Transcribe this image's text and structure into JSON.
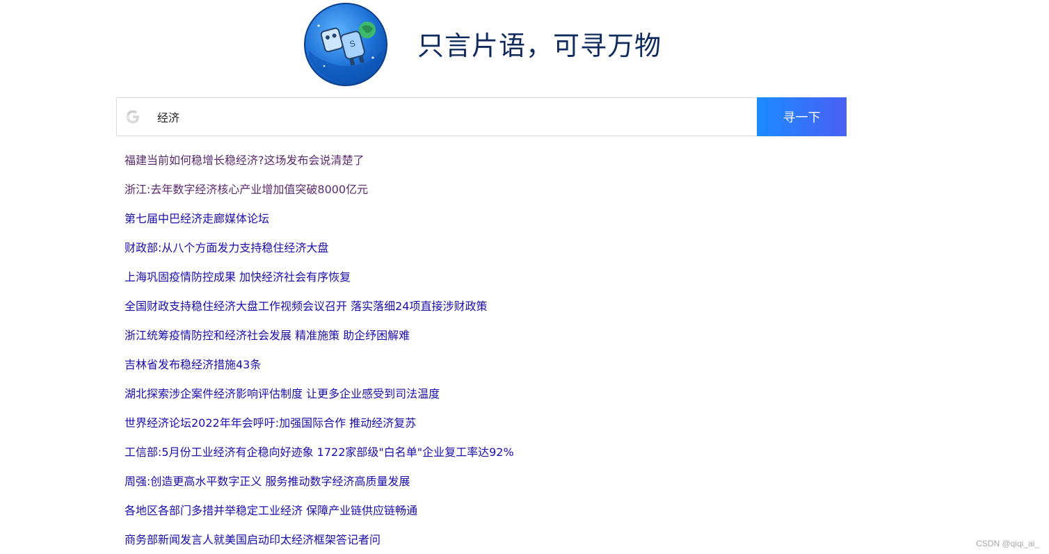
{
  "header": {
    "slogan": "只言片语，可寻万物"
  },
  "search": {
    "query": "经济",
    "button_label": "寻一下",
    "icon": "google-g-icon"
  },
  "results": [
    {
      "title": "福建当前如何稳增长稳经济?这场发布会说清楚了",
      "visited": true
    },
    {
      "title": "浙江:去年数字经济核心产业增加值突破8000亿元",
      "visited": true
    },
    {
      "title": "第七届中巴经济走廊媒体论坛",
      "visited": false
    },
    {
      "title": "财政部:从八个方面发力支持稳住经济大盘",
      "visited": false
    },
    {
      "title": "上海巩固疫情防控成果 加快经济社会有序恢复",
      "visited": false
    },
    {
      "title": "全国财政支持稳住经济大盘工作视频会议召开 落实落细24项直接涉财政策",
      "visited": false
    },
    {
      "title": "浙江统筹疫情防控和经济社会发展 精准施策 助企纾困解难",
      "visited": false
    },
    {
      "title": "吉林省发布稳经济措施43条",
      "visited": false
    },
    {
      "title": "湖北探索涉企案件经济影响评估制度 让更多企业感受到司法温度",
      "visited": false
    },
    {
      "title": "世界经济论坛2022年年会呼吁:加强国际合作 推动经济复苏",
      "visited": false
    },
    {
      "title": "工信部:5月份工业经济有企稳向好迹象 1722家部级\"白名单\"企业复工率达92%",
      "visited": false
    },
    {
      "title": "周强:创造更高水平数字正义 服务推动数字经济高质量发展",
      "visited": false
    },
    {
      "title": "各地区各部门多措并举稳定工业经济 保障产业链供应链畅通",
      "visited": false
    },
    {
      "title": "商务部新闻发言人就美国启动印太经济框架答记者问",
      "visited": false
    }
  ],
  "watermark": "CSDN @qiqi_ai_",
  "colors": {
    "link": "#1a0dab",
    "link_visited": "#5a2a6f",
    "button_start": "#1b8bff",
    "button_end": "#4a60f5",
    "slogan": "#0f2a5c"
  }
}
